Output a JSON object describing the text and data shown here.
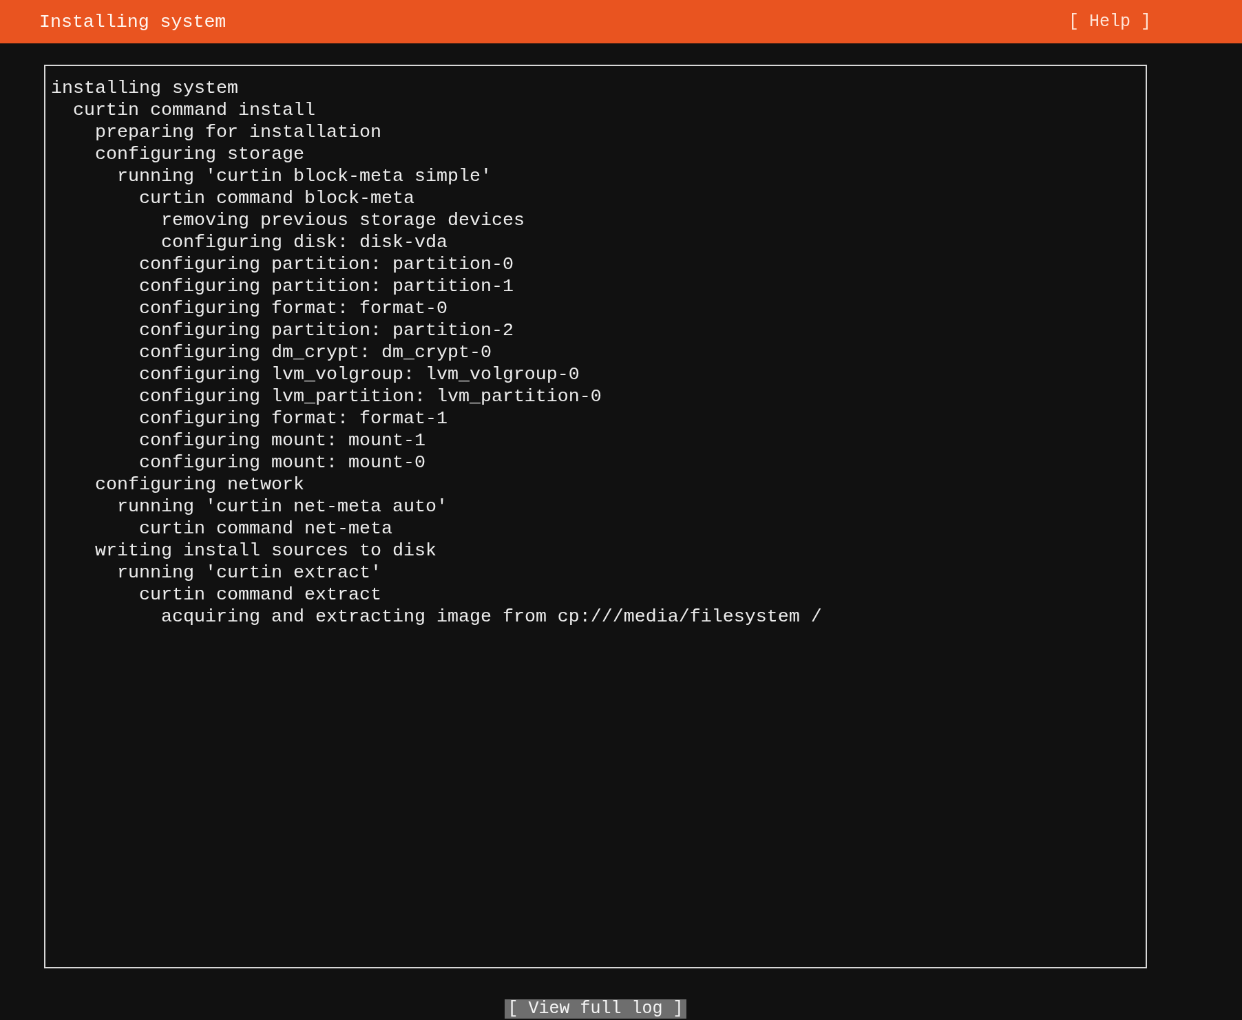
{
  "header": {
    "title": "Installing system",
    "help_button": "[ Help ]"
  },
  "log": [
    {
      "text": "installing system",
      "children": [
        {
          "text": "curtin command install",
          "children": [
            {
              "text": "preparing for installation"
            },
            {
              "text": "configuring storage",
              "children": [
                {
                  "text": "running 'curtin block-meta simple'",
                  "children": [
                    {
                      "text": "curtin command block-meta",
                      "children": [
                        {
                          "text": "removing previous storage devices"
                        },
                        {
                          "text": "configuring disk: disk-vda"
                        }
                      ]
                    },
                    {
                      "text": "configuring partition: partition-0"
                    },
                    {
                      "text": "configuring partition: partition-1"
                    },
                    {
                      "text": "configuring format: format-0"
                    },
                    {
                      "text": "configuring partition: partition-2"
                    },
                    {
                      "text": "configuring dm_crypt: dm_crypt-0"
                    },
                    {
                      "text": "configuring lvm_volgroup: lvm_volgroup-0"
                    },
                    {
                      "text": "configuring lvm_partition: lvm_partition-0"
                    },
                    {
                      "text": "configuring format: format-1"
                    },
                    {
                      "text": "configuring mount: mount-1"
                    },
                    {
                      "text": "configuring mount: mount-0"
                    }
                  ]
                }
              ]
            },
            {
              "text": "configuring network",
              "children": [
                {
                  "text": "running 'curtin net-meta auto'",
                  "children": [
                    {
                      "text": "curtin command net-meta"
                    }
                  ]
                }
              ]
            },
            {
              "text": "writing install sources to disk",
              "children": [
                {
                  "text": "running 'curtin extract'",
                  "children": [
                    {
                      "text": "curtin command extract",
                      "children": [
                        {
                          "text": "acquiring and extracting image from cp:///media/filesystem /"
                        }
                      ]
                    }
                  ]
                }
              ]
            }
          ]
        }
      ]
    }
  ],
  "view_log_button": "[ View full log ]"
}
